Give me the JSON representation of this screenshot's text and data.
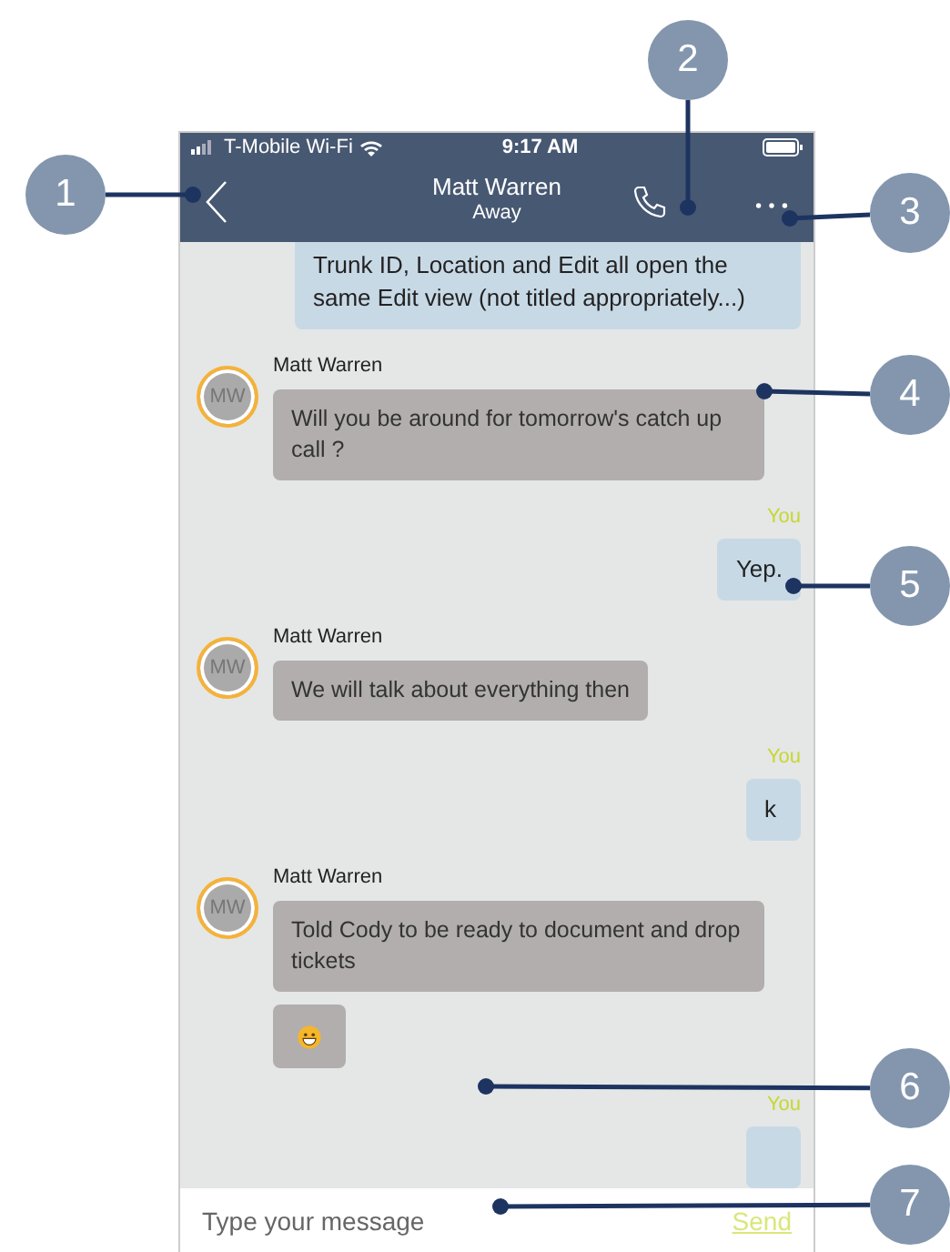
{
  "status_bar": {
    "carrier": "T-Mobile Wi-Fi",
    "time": "9:17 AM"
  },
  "header": {
    "title": "Matt Warren",
    "subtitle": "Away"
  },
  "messages": [
    {
      "kind": "outgoing",
      "text": "Trunk ID, Location and Edit all open the same Edit view (not titled appropriately...)"
    },
    {
      "kind": "incoming",
      "sender": "Matt Warren",
      "avatar": "MW",
      "text": "Will you be around for tomorrow's catch up call ?"
    },
    {
      "kind": "outgoing",
      "sender": "You",
      "text": "Yep."
    },
    {
      "kind": "incoming",
      "sender": "Matt Warren",
      "avatar": "MW",
      "text": "We will talk about everything then"
    },
    {
      "kind": "outgoing",
      "sender": "You",
      "text": "k"
    },
    {
      "kind": "incoming",
      "sender": "Matt Warren",
      "avatar": "MW",
      "text": "Told Cody to be ready to document and drop tickets"
    },
    {
      "kind": "emoji"
    },
    {
      "kind": "outgoing",
      "sender": "You"
    }
  ],
  "composer": {
    "placeholder": "Type your message",
    "send": "Send"
  },
  "callouts": [
    "1",
    "2",
    "3",
    "4",
    "5",
    "6",
    "7"
  ]
}
